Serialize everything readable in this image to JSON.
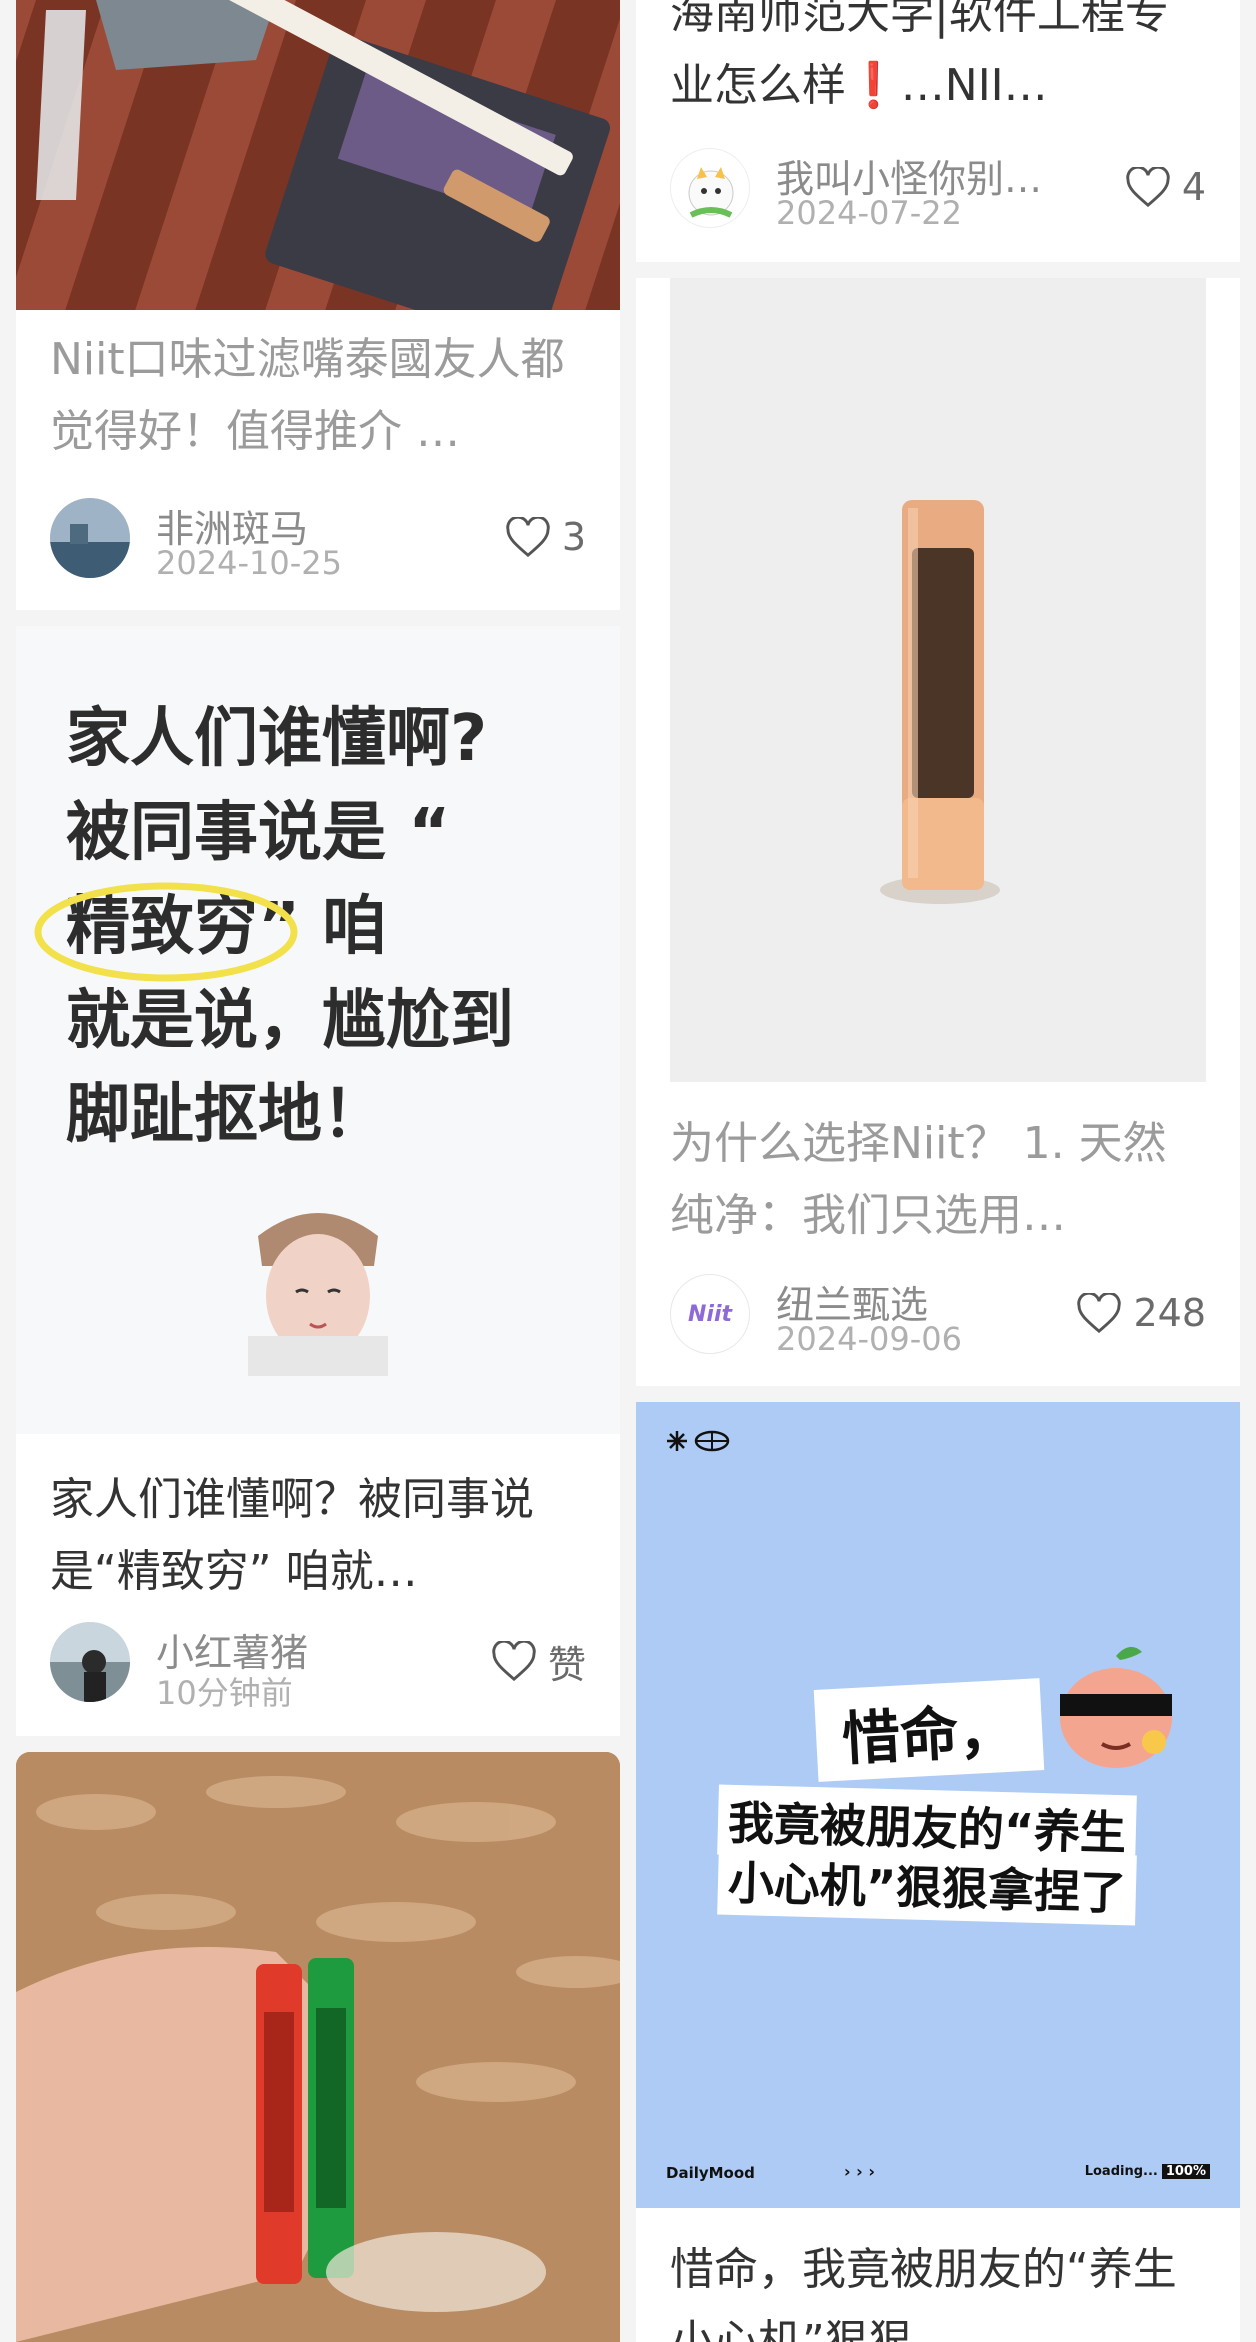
{
  "feed": {
    "cards": [
      {
        "title": "Niit口味过滤嘴泰國友人都觉得好！值得推介 …",
        "author": "非洲斑马",
        "date": "2024-10-25",
        "likes": "3",
        "image": "cigarette-pack-photo"
      },
      {
        "title": "海南师范大学|软件工程专业怎么样❗…NII…",
        "author": "我叫小怪你别…",
        "date": "2024-07-22",
        "likes": "4",
        "image": "cat-avatar"
      },
      {
        "title": "为什么选择Niit？ 1. 天然纯净：我们只选用…",
        "author": "纽兰甄选",
        "date": "2024-09-06",
        "likes": "248",
        "image": "filter-tube-photo",
        "avatar_text": "Niit"
      },
      {
        "cover_lines": [
          "家人们谁懂啊?",
          "被同事说是 “",
          "精致穷”  咱",
          "就是说，尴尬到",
          "脚趾抠地！"
        ],
        "title": "家人们谁懂啊？被同事说是“精致穷” 咱就…",
        "author": "小红薯猪",
        "date": "10分钟前",
        "likes": "赞",
        "image": "buddha-statue-sticker"
      },
      {
        "cover": {
          "line1": "惜命，",
          "line2": "我竟被朋友的“养生",
          "line3": "小心机”狠狠拿捏了",
          "brand": "DailyMood",
          "dots": "› › ›",
          "loading": "Loading...",
          "percent": "100%"
        },
        "title": "惜命，我竟被朋友的“养生小心机”狠狠…",
        "image": "sunglasses-peach-sticker"
      },
      {
        "image": "hand-holding-filters-photo"
      }
    ]
  },
  "colors": {
    "card_bg": "#ffffff",
    "page_bg": "#f4f4f4",
    "blue_cover": "#aecbf5",
    "highlight_yellow": "#f2e14a"
  }
}
